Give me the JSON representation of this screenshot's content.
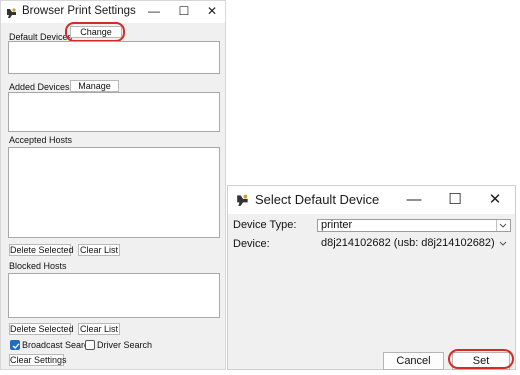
{
  "print_settings": {
    "title": "Browser Print Settings",
    "window_controls": {
      "minimize": "—",
      "maximize": "☐",
      "close": "✕"
    },
    "default_devices": {
      "label": "Default Devices",
      "change_button": "Change"
    },
    "added_devices": {
      "label": "Added Devices",
      "manage_button": "Manage"
    },
    "accepted_hosts": {
      "label": "Accepted Hosts",
      "delete_button": "Delete Selected",
      "clear_button": "Clear List"
    },
    "blocked_hosts": {
      "label": "Blocked Hosts",
      "delete_button": "Delete Selected",
      "clear_button": "Clear List"
    },
    "broadcast_search": {
      "label": "Broadcast Search",
      "checked": true
    },
    "driver_search": {
      "label": "Driver Search",
      "checked": false
    },
    "clear_settings_button": "Clear Settings"
  },
  "select_device": {
    "title": "Select Default Device",
    "window_controls": {
      "minimize": "—",
      "maximize": "☐",
      "close": "✕"
    },
    "device_type": {
      "label": "Device Type:",
      "value": "printer"
    },
    "device": {
      "label": "Device:",
      "value": "d8j214102682 (usb: d8j214102682)"
    },
    "cancel_button": "Cancel",
    "set_button": "Set"
  },
  "colors": {
    "highlight_ring": "#d52a25",
    "checkbox_accent": "#1f6dc1",
    "window_background": "#f0f0f0"
  },
  "icons": {
    "app": "printer-app-icon",
    "dropdown": "chevron-down-icon",
    "checkmark": "check-icon"
  }
}
